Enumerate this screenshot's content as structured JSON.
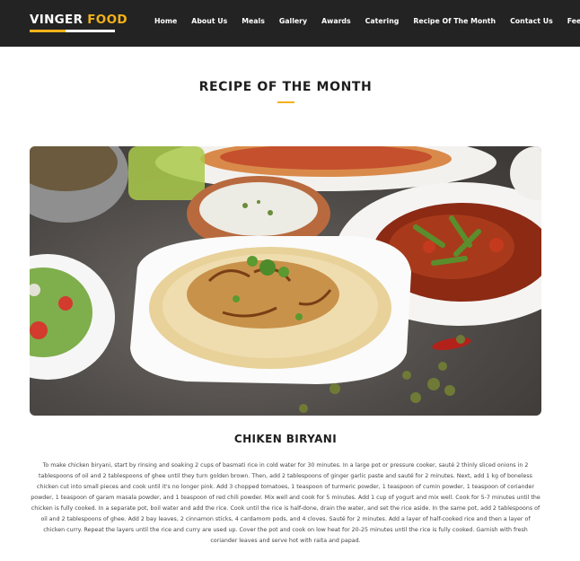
{
  "brand": {
    "name_part1": "VINGER",
    "name_part2": "FOOD",
    "accent_color": "#f2b21b"
  },
  "nav": {
    "items": [
      {
        "label": "Home"
      },
      {
        "label": "About Us"
      },
      {
        "label": "Meals"
      },
      {
        "label": "Gallery"
      },
      {
        "label": "Awards"
      },
      {
        "label": "Catering"
      },
      {
        "label": "Recipe Of The Month"
      },
      {
        "label": "Contact Us"
      },
      {
        "label": "Feedback"
      }
    ]
  },
  "section": {
    "title": "RECIPE OF THE MONTH"
  },
  "recipe": {
    "name": "CHIKEN BIRYANI",
    "description": "To make chicken biryani, start by rinsing and soaking 2 cups of basmati rice in cold water for 30 minutes. In a large pot or pressure cooker, sauté 2 thinly sliced onions in 2 tablespoons of oil and 2 tablespoons of ghee until they turn golden brown. Then, add 2 tablespoons of ginger garlic paste and sauté for 2 minutes. Next, add 1 kg of boneless chicken cut into small pieces and cook until it's no longer pink. Add 3 chopped tomatoes, 1 teaspoon of turmeric powder, 1 teaspoon of cumin powder, 1 teaspoon of coriander powder, 1 teaspoon of garam masala powder, and 1 teaspoon of red chili powder. Mix well and cook for 5 minutes. Add 1 cup of yogurt and mix well. Cook for 5-7 minutes until the chicken is fully cooked. In a separate pot, boil water and add the rice. Cook until the rice is half-done, drain the water, and set the rice aside. In the same pot, add 2 tablespoons of oil and 2 tablespoons of ghee. Add 2 bay leaves, 2 cinnamon sticks, 4 cardamom pods, and 4 cloves. Sauté for 2 minutes. Add a layer of half-cooked rice and then a layer of chicken curry. Repeat the layers until the rice and curry are used up. Cover the pot and cook on low heat for 20-25 minutes until the rice is fully cooked. Garnish with fresh coriander leaves and serve hot with raita and papad."
  }
}
